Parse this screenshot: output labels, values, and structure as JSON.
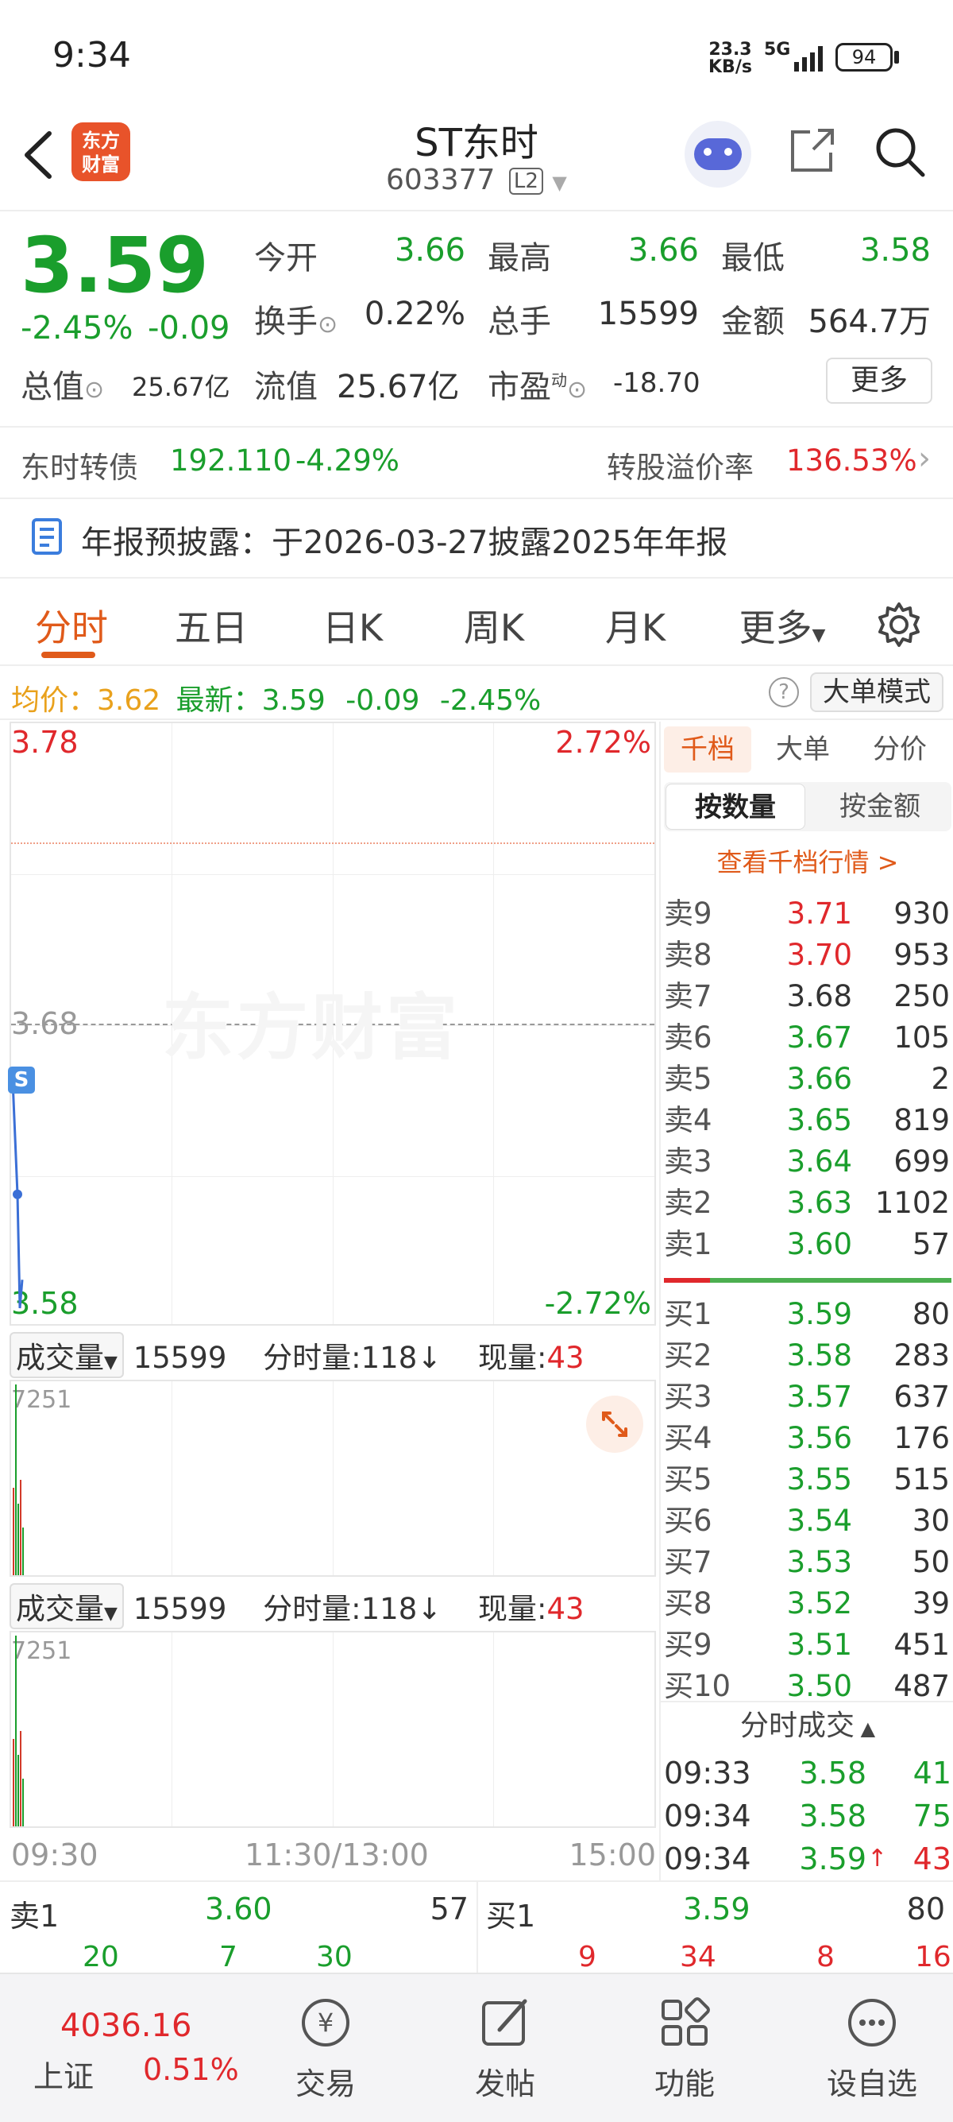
{
  "status_bar": {
    "time": "9:34",
    "net_speed_value": "23.3",
    "net_speed_unit": "KB/s",
    "network": "5G",
    "battery": "94"
  },
  "header": {
    "app_logo_text_top": "东方",
    "app_logo_text_bottom": "财富",
    "stock_name": "ST东时",
    "stock_code": "603377",
    "level_badge": "L2"
  },
  "quote": {
    "price": "3.59",
    "change_pct": "-2.45%",
    "change_amt": "-0.09",
    "open_label": "今开",
    "open_val": "3.66",
    "high_label": "最高",
    "high_val": "3.66",
    "low_label": "最低",
    "low_val": "3.58",
    "turnover_label": "换手",
    "turnover_val": "0.22%",
    "volume_label": "总手",
    "volume_val": "15599",
    "amount_label": "金额",
    "amount_val": "564.7万",
    "mktcap_label": "总值",
    "mktcap_val": "25.67亿",
    "float_label": "流值",
    "float_val": "25.67亿",
    "pe_label": "市盈",
    "pe_sup": "动",
    "pe_val": "-18.70",
    "more_label": "更多"
  },
  "bond": {
    "name": "东时转债",
    "price": "192.110",
    "change": "-4.29%",
    "premium_label": "转股溢价率",
    "premium_val": "136.53%"
  },
  "notice": {
    "text": "年报预披露：于2026-03-27披露2025年年报"
  },
  "tabs": [
    "分时",
    "五日",
    "日K",
    "周K",
    "月K",
    "更多"
  ],
  "summary": {
    "avg_label": "均价：",
    "avg_val": "3.62",
    "latest_label": "最新：",
    "latest_val": "3.59",
    "latest_chg": "-0.09",
    "latest_pct": "-2.45%",
    "big_order_label": "大单模式"
  },
  "chart": {
    "y_top": "3.78",
    "y_top_pct": "2.72%",
    "y_mid": "3.68",
    "y_bottom": "3.58",
    "y_bottom_pct": "-2.72%",
    "watermark": "东方财富",
    "s_marker": "S",
    "x_start": "09:30",
    "x_mid": "11:30/13:00",
    "x_end": "15:00"
  },
  "chart_data": {
    "type": "line",
    "x": [
      "09:30",
      "09:31",
      "09:32",
      "09:33",
      "09:34"
    ],
    "series": [
      {
        "values": [
          3.66,
          3.64,
          3.62,
          3.58,
          3.59
        ]
      }
    ],
    "ylim": [
      3.58,
      3.78
    ],
    "xlabel": "",
    "ylabel": ""
  },
  "volume_panels": [
    {
      "select_label": "成交量",
      "total": "15599",
      "per_min_label": "分时量:118",
      "arrow": "↓",
      "now_label": "现量:",
      "now_val": "43",
      "max_label": "7251"
    },
    {
      "select_label": "成交量",
      "total": "15599",
      "per_min_label": "分时量:118",
      "arrow": "↓",
      "now_label": "现量:",
      "now_val": "43",
      "max_label": "7251"
    }
  ],
  "orderbook": {
    "tabs": [
      "千档",
      "大单",
      "分价"
    ],
    "sub_tabs": [
      "按数量",
      "按金额"
    ],
    "view_link": "查看千档行情 >",
    "asks": [
      {
        "label": "卖9",
        "price": "3.71",
        "vol": "930",
        "color": "red",
        "dot": "blue"
      },
      {
        "label": "卖8",
        "price": "3.70",
        "vol": "953",
        "color": "red",
        "dot": "gray"
      },
      {
        "label": "卖7",
        "price": "3.68",
        "vol": "250",
        "color": "dark",
        "dot": "gray"
      },
      {
        "label": "卖6",
        "price": "3.67",
        "vol": "105",
        "color": "green",
        "dot": "gray"
      },
      {
        "label": "卖5",
        "price": "3.66",
        "vol": "2",
        "color": "green",
        "dot": "gray"
      },
      {
        "label": "卖4",
        "price": "3.65",
        "vol": "819",
        "color": "green",
        "dot": "blue"
      },
      {
        "label": "卖3",
        "price": "3.64",
        "vol": "699",
        "color": "green",
        "dot": "gray"
      },
      {
        "label": "卖2",
        "price": "3.63",
        "vol": "1102",
        "color": "green",
        "dot": "blue"
      },
      {
        "label": "卖1",
        "price": "3.60",
        "vol": "57",
        "color": "green",
        "dot": "gray"
      }
    ],
    "bids": [
      {
        "label": "买1",
        "price": "3.59",
        "vol": "80",
        "color": "green",
        "dot": "gray"
      },
      {
        "label": "买2",
        "price": "3.58",
        "vol": "283",
        "color": "green",
        "dot": "gray"
      },
      {
        "label": "买3",
        "price": "3.57",
        "vol": "637",
        "color": "green",
        "dot": "gray"
      },
      {
        "label": "买4",
        "price": "3.56",
        "vol": "176",
        "color": "green",
        "dot": "gray"
      },
      {
        "label": "买5",
        "price": "3.55",
        "vol": "515",
        "color": "green",
        "dot": "gray"
      },
      {
        "label": "买6",
        "price": "3.54",
        "vol": "30",
        "color": "green",
        "dot": "gray"
      },
      {
        "label": "买7",
        "price": "3.53",
        "vol": "50",
        "color": "green",
        "dot": "gray"
      },
      {
        "label": "买8",
        "price": "3.52",
        "vol": "39",
        "color": "green",
        "dot": "gray"
      },
      {
        "label": "买9",
        "price": "3.51",
        "vol": "451",
        "color": "green",
        "dot": "gray"
      },
      {
        "label": "买10",
        "price": "3.50",
        "vol": "487",
        "color": "green",
        "dot": "gray"
      }
    ]
  },
  "ticks": {
    "title": "分时成交",
    "rows": [
      {
        "time": "09:33",
        "price": "3.58",
        "vol": "41",
        "vol_color": "green",
        "arrow": ""
      },
      {
        "time": "09:34",
        "price": "3.58",
        "vol": "75",
        "vol_color": "green",
        "arrow": ""
      },
      {
        "time": "09:34",
        "price": "3.59",
        "vol": "43",
        "vol_color": "red",
        "arrow": "↑"
      }
    ]
  },
  "bottom_quote": {
    "sell_label": "卖1",
    "sell_price": "3.60",
    "sell_vol": "57",
    "sell_details": [
      "20",
      "7",
      "30"
    ],
    "buy_label": "买1",
    "buy_price": "3.59",
    "buy_vol": "80",
    "buy_details": [
      "9",
      "34",
      "8",
      "16"
    ]
  },
  "bottom_nav": {
    "index_value": "4036.16",
    "index_name": "上证",
    "index_pct": "0.51%",
    "items": [
      "交易",
      "发帖",
      "功能",
      "设自选"
    ]
  }
}
